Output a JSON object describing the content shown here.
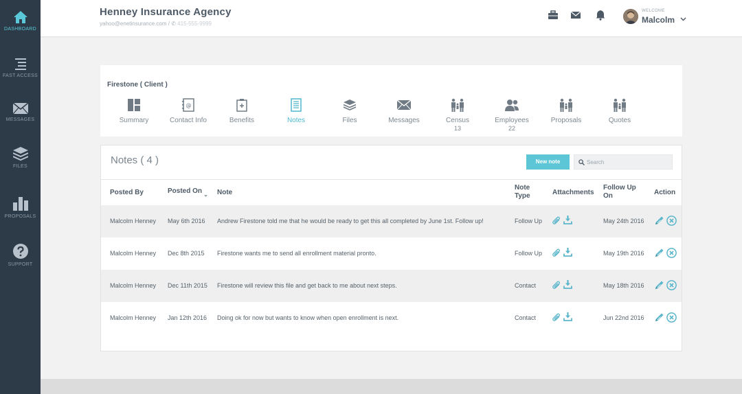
{
  "sidebar": {
    "items": [
      {
        "label": "DASHBOARD",
        "icon": "home-icon",
        "active": true
      },
      {
        "label": "FAST ACCESS",
        "icon": "list-icon",
        "active": false
      },
      {
        "label": "MESSAGES",
        "icon": "envelope-icon",
        "active": false
      },
      {
        "label": "FILES",
        "icon": "layers-icon",
        "active": false
      },
      {
        "label": "PROPOSALS",
        "icon": "bar-chart-icon",
        "active": false
      },
      {
        "label": "SUPPORT",
        "icon": "help-icon",
        "active": false
      }
    ]
  },
  "header": {
    "agency_name": "Henney Insurance Agency",
    "email": "yahoo@enetinsurance.com",
    "separator": "/",
    "phone": "415-555-9999",
    "welcome": "WELCOME",
    "user_name": "Malcolm"
  },
  "client": {
    "title": "Firestone ( Client )",
    "tabs": [
      {
        "label": "Summary",
        "count": "",
        "icon": "summary-icon"
      },
      {
        "label": "Contact Info",
        "count": "",
        "icon": "contact-info-icon"
      },
      {
        "label": "Benefits",
        "count": "",
        "icon": "benefits-icon"
      },
      {
        "label": "Notes",
        "count": "",
        "icon": "notes-icon",
        "active": true
      },
      {
        "label": "Files",
        "count": "",
        "icon": "files-icon"
      },
      {
        "label": "Messages",
        "count": "",
        "icon": "messages-icon"
      },
      {
        "label": "Census",
        "count": "13",
        "icon": "census-icon"
      },
      {
        "label": "Employees",
        "count": "22",
        "icon": "employees-icon"
      },
      {
        "label": "Proposals",
        "count": "",
        "icon": "proposals-icon"
      },
      {
        "label": "Quotes",
        "count": "",
        "icon": "quotes-icon"
      }
    ]
  },
  "notes": {
    "title": "Notes ( 4 )",
    "new_note_label": "New note",
    "search_placeholder": "Search",
    "columns": {
      "posted_by": "Posted By",
      "posted_on": "Posted On",
      "note": "Note",
      "note_type_1": "Note",
      "note_type_2": "Type",
      "attachments": "Attachments",
      "follow_up_1": "Follow Up",
      "follow_up_2": "On",
      "action": "Action"
    },
    "rows": [
      {
        "posted_by": "Malcolm Henney",
        "posted_on": "May 6th 2016",
        "note": "Andrew Firestone told me that he would be ready to get this all completed by June 1st. Follow up!",
        "type": "Follow Up",
        "follow_up_on": "May 24th 2016"
      },
      {
        "posted_by": "Malcolm Henney",
        "posted_on": "Dec 8th 2015",
        "note": "Firestone wants me to send all enrollment material pronto.",
        "type": "Follow Up",
        "follow_up_on": "May 19th 2016"
      },
      {
        "posted_by": "Malcolm Henney",
        "posted_on": "Dec 11th 2015",
        "note": "Firestone will review this file and get back to me about next steps.",
        "type": "Contact",
        "follow_up_on": "May 18th 2016"
      },
      {
        "posted_by": "Malcolm Henney",
        "posted_on": "Jan 12th 2016",
        "note": "Doing ok for now but wants to know when open enrollment is next.",
        "type": "Contact",
        "follow_up_on": "Jun 22nd 2016"
      }
    ]
  },
  "colors": {
    "sidebar_bg": "#2d3a47",
    "accent": "#5cc6d6",
    "text_dark": "#4d5a66"
  }
}
